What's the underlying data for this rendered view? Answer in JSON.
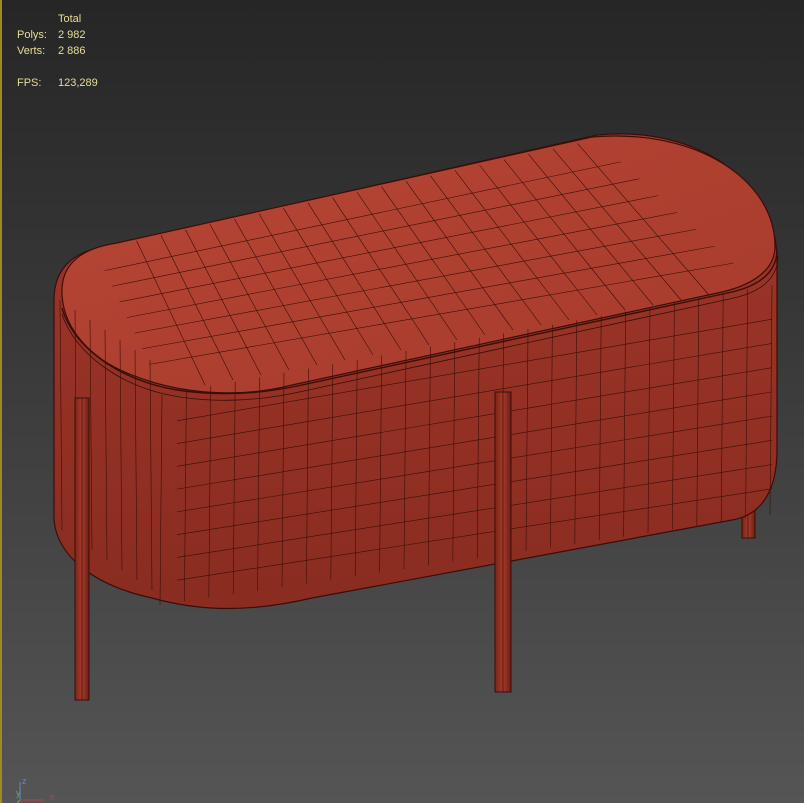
{
  "stats": {
    "header": "Total",
    "polys_label": "Polys:",
    "polys_value": "2 982",
    "verts_label": "Verts:",
    "verts_value": "2 886",
    "fps_label": "FPS:",
    "fps_value": "123,289"
  },
  "gizmo": {
    "z": "z",
    "y": "y",
    "x": "x"
  },
  "colors": {
    "mesh": "#a83a2c",
    "mesh_dark": "#7a2418",
    "wire": "#3a0e08",
    "stats_text": "#e6dc9a",
    "viewport_border": "#a08828"
  }
}
